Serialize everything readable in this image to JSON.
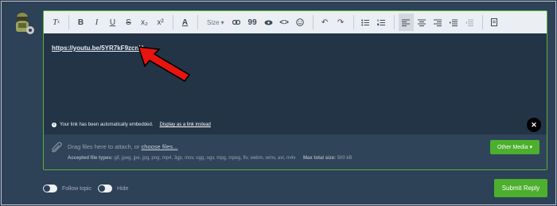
{
  "toolbar": {
    "buttons": [
      {
        "label": "Tx",
        "icon": "clear-formatting-icon"
      },
      {
        "label": "B",
        "icon": "bold-icon"
      },
      {
        "label": "I",
        "icon": "italic-icon"
      },
      {
        "label": "U",
        "icon": "underline-icon"
      },
      {
        "label": "S",
        "icon": "strikethrough-icon"
      },
      {
        "label": "x₂",
        "icon": "subscript-icon"
      },
      {
        "label": "x²",
        "icon": "superscript-icon"
      },
      {
        "label": "A",
        "icon": "font-color-icon"
      },
      {
        "label": "Size",
        "icon": "size-dropdown"
      },
      {
        "icon": "link-icon"
      },
      {
        "label": "99",
        "icon": "quote-icon"
      },
      {
        "icon": "spoiler-eye-icon"
      },
      {
        "icon": "code-icon"
      },
      {
        "icon": "emoji-icon"
      },
      {
        "icon": "undo-icon"
      },
      {
        "icon": "redo-icon"
      },
      {
        "icon": "bullet-list-icon"
      },
      {
        "icon": "numbered-list-icon"
      },
      {
        "icon": "align-left-icon"
      },
      {
        "icon": "align-center-icon"
      },
      {
        "icon": "align-right-icon"
      },
      {
        "icon": "indent-icon"
      },
      {
        "icon": "outdent-icon"
      },
      {
        "icon": "drafts-icon"
      }
    ],
    "size_label": "Size",
    "color_label": "A",
    "clear_label": "T",
    "bold_label": "B",
    "italic_label": "I",
    "underline_label": "U",
    "strike_label": "S",
    "subscript_label": "x₂",
    "superscript_label": "x²",
    "quote_label": "99"
  },
  "editor": {
    "link_text": "https://youtu.be/5YR7kF9zcnU",
    "notice_text": "Your link has been automatically embedded.",
    "notice_link": "Display as a link instead",
    "close_symbol": "✕",
    "info_symbol": "i"
  },
  "attachments": {
    "drag_text": "Drag files here to attach, or ",
    "choose_text": "choose files...",
    "accepted_label": "Accepted file types:",
    "accepted_types": "gif, jpeg, jpe, jpg, png, mp4, 3gp, mov, ogg, ogv, mpg, mpeg, flv, webm, wmv, avi, m4v",
    "max_label": "Max total size:",
    "max_value": "500 kB",
    "other_media_label": "Other Media"
  },
  "options": {
    "follow_label": "Follow topic",
    "hide_label": "Hide"
  },
  "submit_label": "Submit Reply",
  "colors": {
    "accent": "#4caf2e",
    "background": "#2d4157",
    "editor_bg": "#243447",
    "arrow": "#e8140f"
  }
}
